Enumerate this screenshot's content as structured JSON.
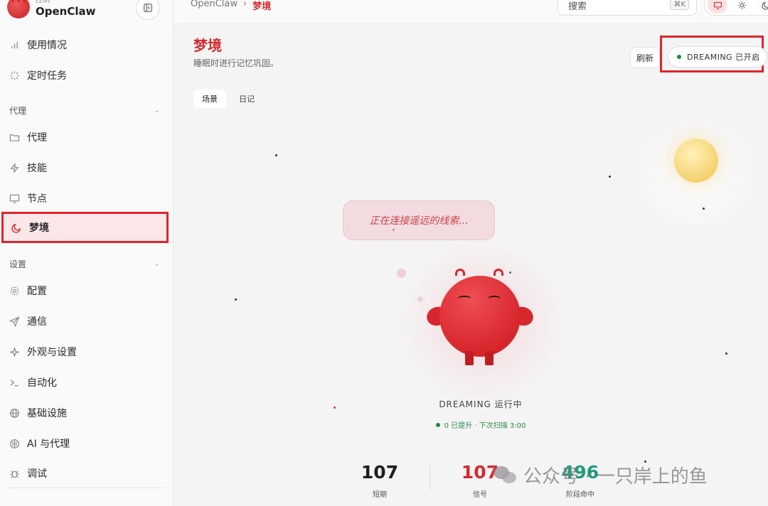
{
  "brand": {
    "sub": "控制",
    "name": "OpenClaw"
  },
  "sidebar": {
    "top_items": [
      {
        "label": "使用情况",
        "icon": "bar-chart-icon"
      },
      {
        "label": "定时任务",
        "icon": "loader-icon"
      }
    ],
    "section_agent": "代理",
    "agent_items": [
      {
        "label": "代理",
        "icon": "folder-icon"
      },
      {
        "label": "技能",
        "icon": "zap-icon"
      },
      {
        "label": "节点",
        "icon": "monitor-icon"
      },
      {
        "label": "梦境",
        "icon": "moon-icon",
        "active": true
      }
    ],
    "section_settings": "设置",
    "settings_items": [
      {
        "label": "配置",
        "icon": "gear-icon"
      },
      {
        "label": "通信",
        "icon": "send-icon"
      },
      {
        "label": "外观与设置",
        "icon": "sparkle-icon"
      },
      {
        "label": "自动化",
        "icon": "terminal-icon"
      },
      {
        "label": "基础设施",
        "icon": "globe-icon"
      },
      {
        "label": "AI 与代理",
        "icon": "brain-icon"
      },
      {
        "label": "调试",
        "icon": "bug-icon"
      }
    ]
  },
  "topbar": {
    "breadcrumb_root": "OpenClaw",
    "breadcrumb_sep": "›",
    "breadcrumb_current": "梦境",
    "search_placeholder": "搜索",
    "search_shortcut": "⌘K"
  },
  "page": {
    "title": "梦境",
    "subtitle": "睡眠时进行记忆巩固。",
    "refresh_label": "刷新",
    "dreaming_label": "DREAMING 已开启",
    "tabs": [
      "场景",
      "日记"
    ],
    "active_tab": "场景"
  },
  "scene": {
    "bubble_text": "正在连接遥远的线索...",
    "status": "DREAMING 运行中",
    "substatus": "0 已提升 · 下次扫描 3:00"
  },
  "stats": [
    {
      "value": "107",
      "label": "短期"
    },
    {
      "value": "107",
      "label": "信号"
    },
    {
      "value": "496",
      "label": "阶段命中"
    }
  ],
  "watermark": {
    "text": "公众号 · 一只岸上的鱼"
  },
  "colors": {
    "accent": "#d42b30",
    "success": "#1f8a3d",
    "teal": "#1f9a7a"
  }
}
